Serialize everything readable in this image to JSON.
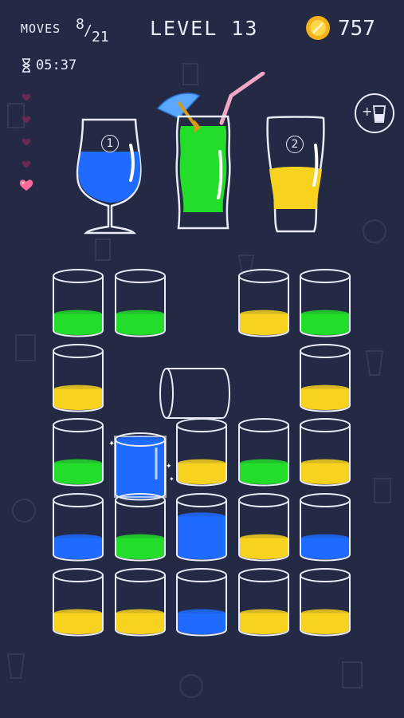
{
  "hud": {
    "moves_label": "MOVES",
    "moves_current": "8",
    "moves_slash": "/",
    "moves_total": "21",
    "level": "LEVEL 13",
    "coins": "757",
    "timer": "05:37"
  },
  "lives": {
    "total": 5,
    "filled": 1
  },
  "colors": {
    "background": "#252a44",
    "green": "#22dd2a",
    "yellow": "#f7d21e",
    "blue": "#1f6bff",
    "heart_active": "#ff6b9a",
    "heart_inactive": "#6a2950"
  },
  "target_drinks": [
    {
      "name": "blue-cocktail",
      "number": "1",
      "color": "blue"
    },
    {
      "name": "green-mojito",
      "number": "",
      "color": "green"
    },
    {
      "name": "beer-glass",
      "number": "2",
      "color": "yellow"
    }
  ],
  "add_glass_button": {
    "icon": "add-glass-icon",
    "plus": "+"
  },
  "grid": [
    [
      "green",
      "green",
      null,
      "yellow",
      "green"
    ],
    [
      "yellow",
      null,
      null,
      null,
      "yellow"
    ],
    [
      "green",
      "blue",
      "yellow",
      "green",
      "yellow"
    ],
    [
      "blue",
      "green",
      "blue",
      "yellow",
      "blue"
    ],
    [
      "yellow",
      "yellow",
      "blue",
      "yellow",
      "yellow"
    ]
  ],
  "fill_levels": [
    [
      0.3,
      0.3,
      null,
      0.3,
      0.3
    ],
    [
      0.3,
      null,
      null,
      null,
      0.3
    ],
    [
      0.3,
      1.0,
      0.3,
      0.3,
      0.3
    ],
    [
      0.3,
      0.3,
      0.7,
      0.3,
      0.3
    ],
    [
      0.3,
      0.3,
      0.3,
      0.3,
      0.3
    ]
  ],
  "selected_cup": {
    "row": 2,
    "col": 1
  },
  "tipped_cup": {
    "row": 1,
    "col": 2
  }
}
